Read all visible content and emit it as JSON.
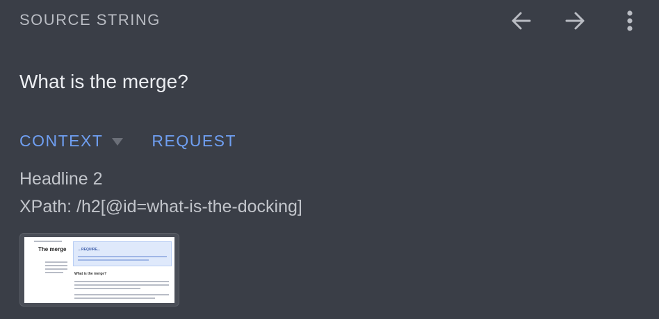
{
  "header": {
    "title": "SOURCE STRING",
    "back_icon": "arrow-left-icon",
    "forward_icon": "arrow-right-icon",
    "more_icon": "more-vert-icon"
  },
  "source": {
    "text": "What is the merge?"
  },
  "tabs": [
    {
      "label": "CONTEXT"
    },
    {
      "label": "REQUEST"
    }
  ],
  "context": {
    "element_type": "Headline 2",
    "xpath": "XPath: /h2[@id=what-is-the-docking]"
  },
  "thumbnail": {
    "page_title": "The merge",
    "banner_title": "…REQUIRE...",
    "heading": "What is the merge?"
  },
  "colors": {
    "background": "#3a3e47",
    "accent": "#6f9ff2",
    "muted_text": "#b9bcc3",
    "primary_text": "#eceef2"
  }
}
